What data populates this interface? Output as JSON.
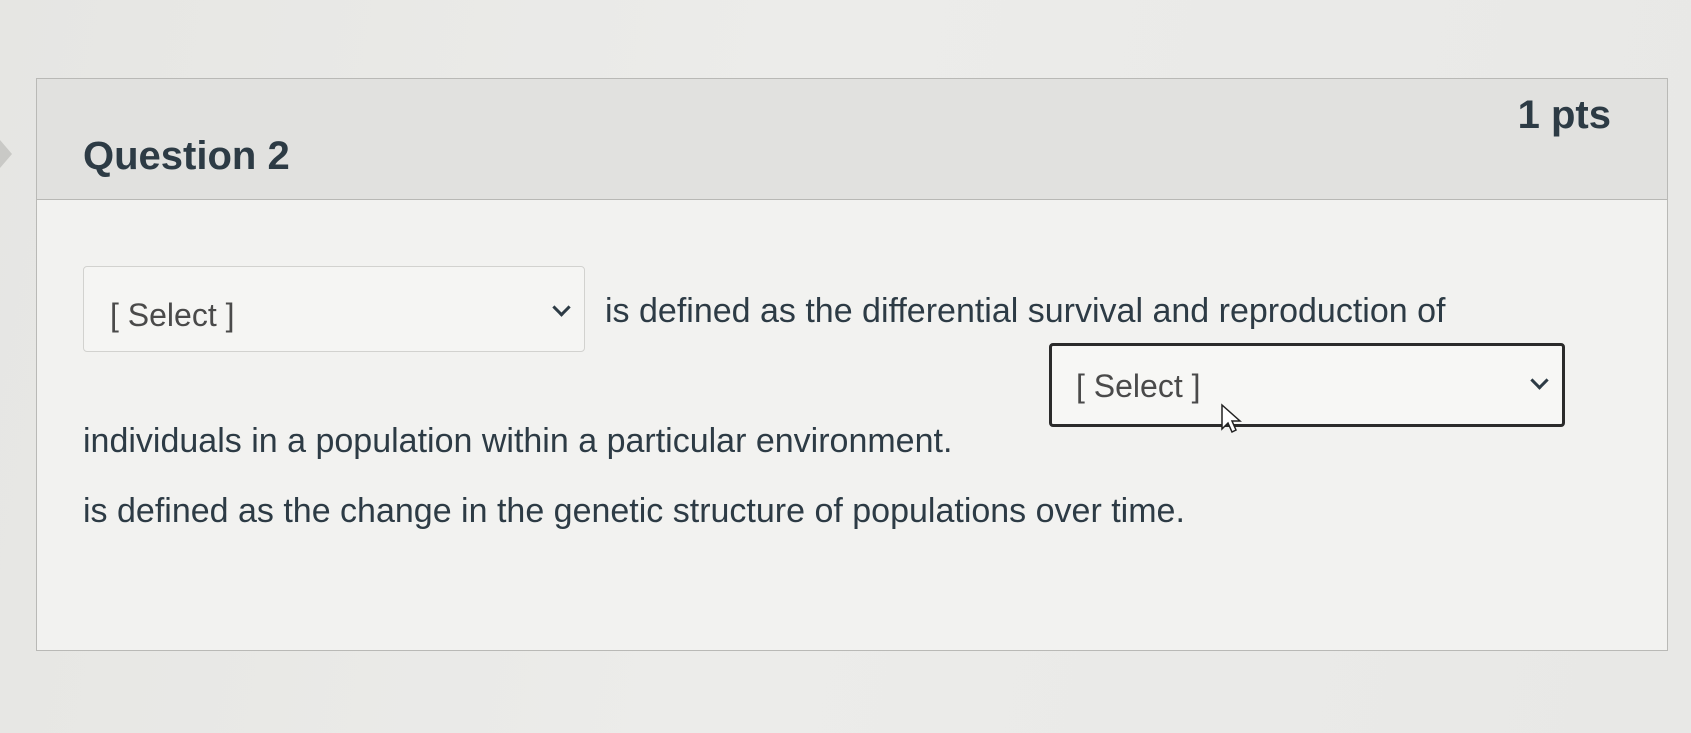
{
  "question": {
    "title": "Question 2",
    "points": "1 pts",
    "sentence_part_1": "is defined as the differential survival and reproduction of",
    "sentence_part_2": "individuals in a population within a particular environment.",
    "sentence_part_3": "is defined as the change in the genetic structure of populations over time.",
    "dropdown_1": {
      "selected": "[ Select ]",
      "icon": "chevron-down-icon"
    },
    "dropdown_2": {
      "selected": "[ Select ]",
      "icon": "chevron-down-icon"
    }
  },
  "colors": {
    "text": "#2d3b45",
    "header_bg": "#e1e1df",
    "card_bg": "#f2f2f0",
    "border": "#b9b9b6"
  },
  "icons": {
    "nav": "chevron-right-icon",
    "pointer": "mouse-cursor-icon"
  }
}
